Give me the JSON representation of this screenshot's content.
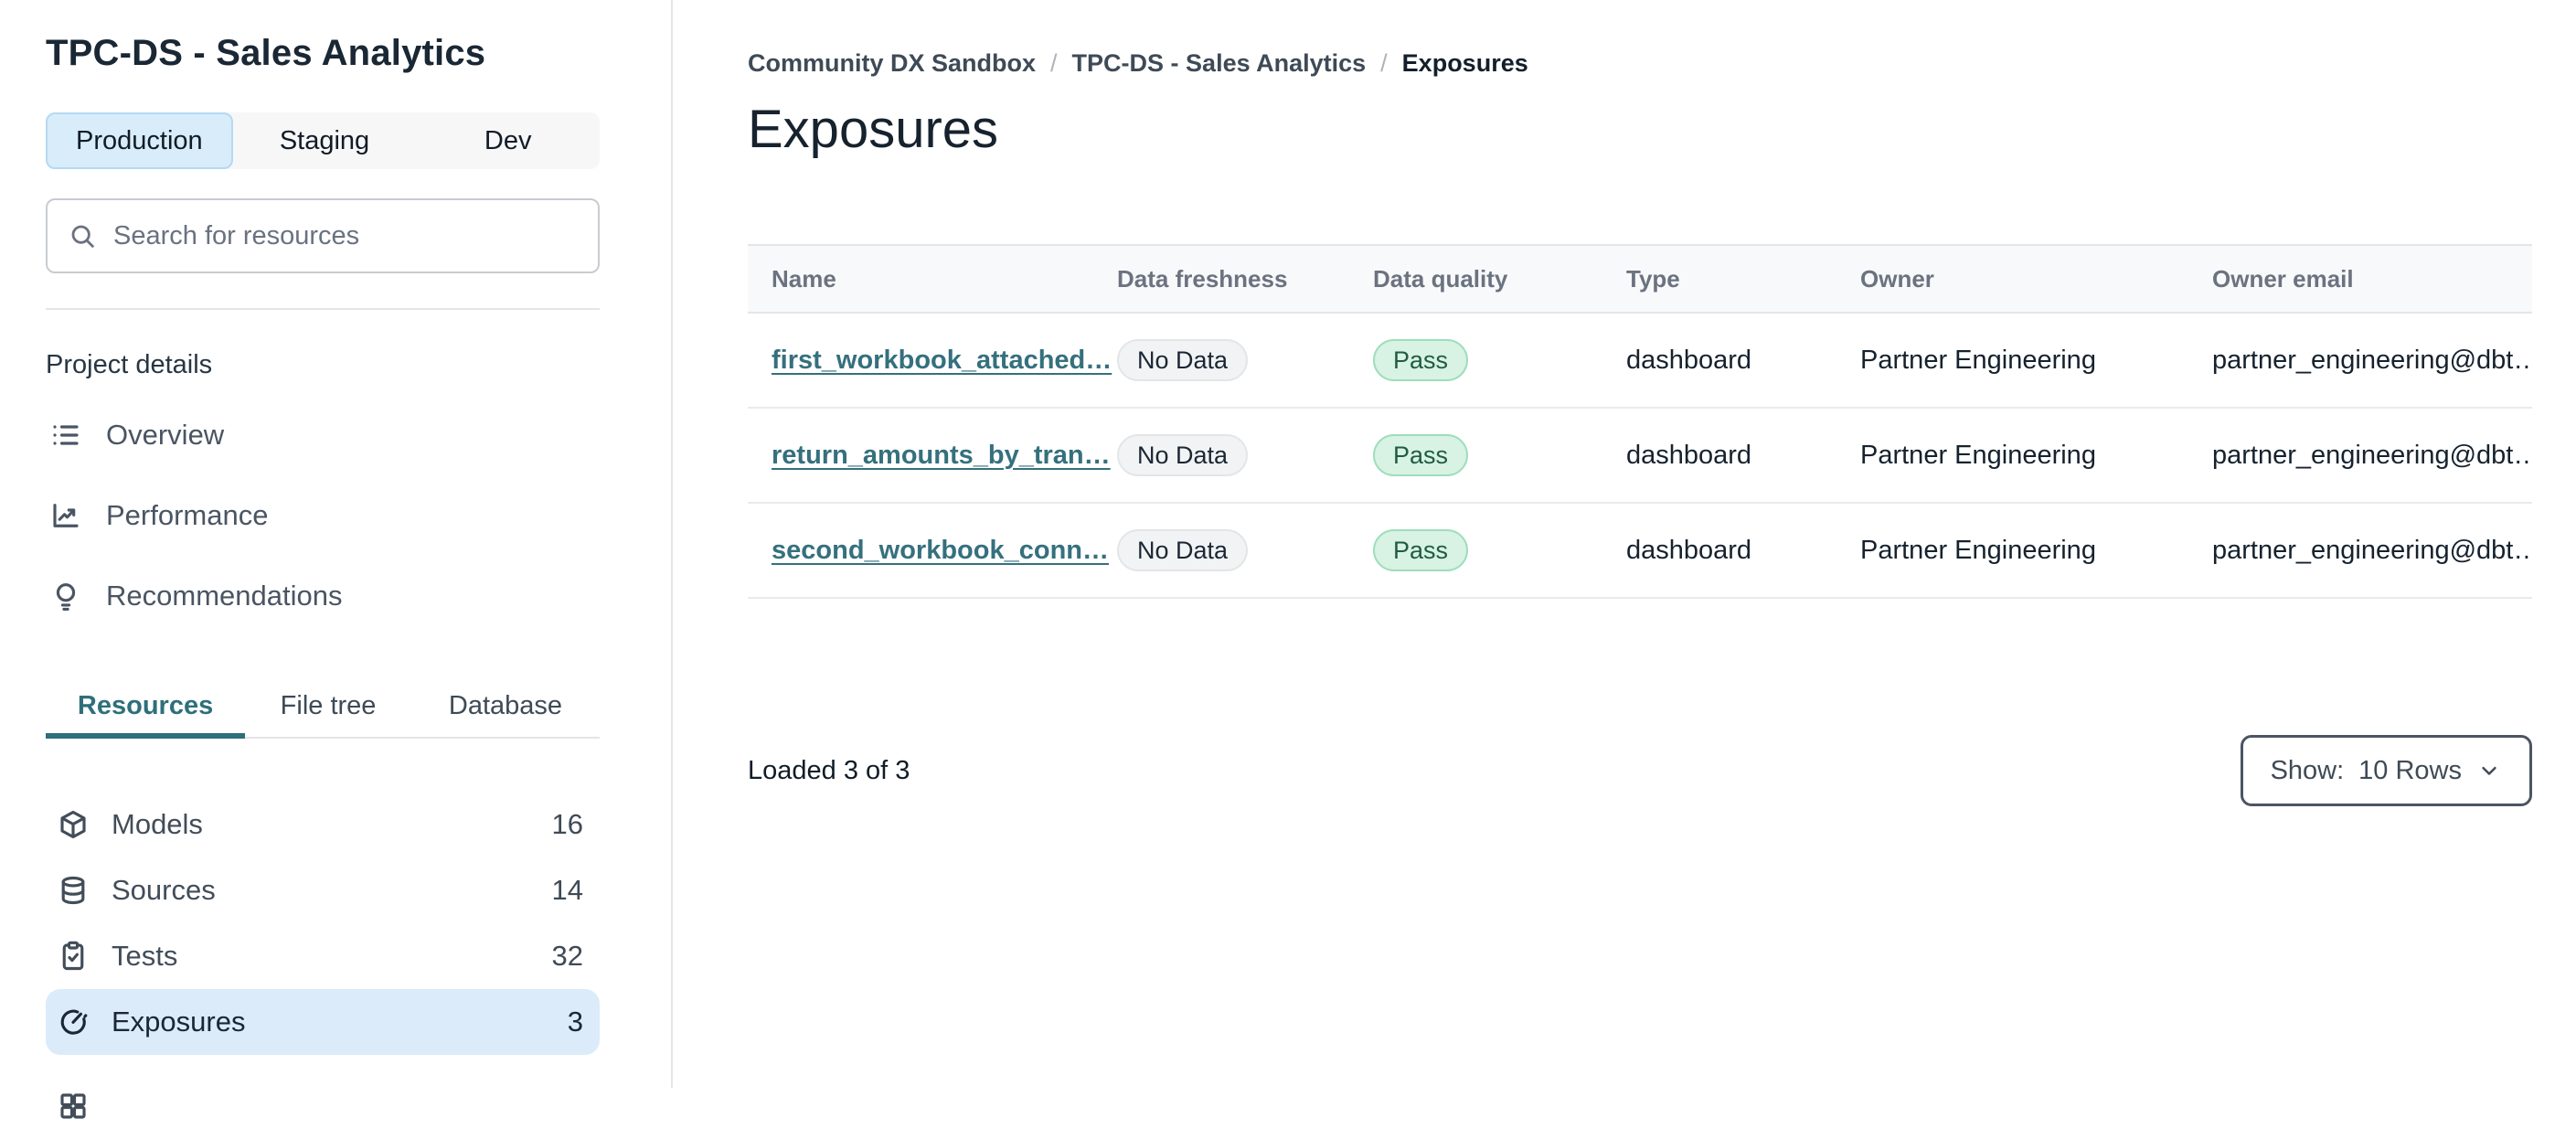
{
  "sidebar": {
    "title": "TPC-DS - Sales Analytics",
    "env_tabs": [
      {
        "label": "Production",
        "active": true
      },
      {
        "label": "Staging",
        "active": false
      },
      {
        "label": "Dev",
        "active": false
      }
    ],
    "search": {
      "placeholder": "Search for resources",
      "icon": "search-icon"
    },
    "section_label": "Project details",
    "nav": [
      {
        "label": "Overview",
        "icon": "list-icon"
      },
      {
        "label": "Performance",
        "icon": "chart-line-icon"
      },
      {
        "label": "Recommendations",
        "icon": "lightbulb-icon"
      }
    ],
    "view_tabs": [
      {
        "label": "Resources",
        "active": true
      },
      {
        "label": "File tree",
        "active": false
      },
      {
        "label": "Database",
        "active": false
      }
    ],
    "resources": [
      {
        "label": "Models",
        "count": "16",
        "icon": "cube-icon",
        "active": false
      },
      {
        "label": "Sources",
        "count": "14",
        "icon": "database-icon",
        "active": false
      },
      {
        "label": "Tests",
        "count": "32",
        "icon": "clipboard-check-icon",
        "active": false
      },
      {
        "label": "Exposures",
        "count": "3",
        "icon": "gauge-icon",
        "active": true
      }
    ],
    "partial_item_icon": "grid-icon"
  },
  "main": {
    "breadcrumb": [
      {
        "label": "Community DX Sandbox"
      },
      {
        "label": "TPC-DS - Sales Analytics"
      },
      {
        "label": "Exposures"
      }
    ],
    "title": "Exposures",
    "table": {
      "columns": [
        "Name",
        "Data freshness",
        "Data quality",
        "Type",
        "Owner",
        "Owner email"
      ],
      "rows": [
        {
          "name": "first_workbook_attached…",
          "freshness": "No Data",
          "quality": "Pass",
          "type": "dashboard",
          "owner": "Partner Engineering",
          "owner_email": "partner_engineering@dbt…"
        },
        {
          "name": "return_amounts_by_tran…",
          "freshness": "No Data",
          "quality": "Pass",
          "type": "dashboard",
          "owner": "Partner Engineering",
          "owner_email": "partner_engineering@dbt…"
        },
        {
          "name": "second_workbook_conn…",
          "freshness": "No Data",
          "quality": "Pass",
          "type": "dashboard",
          "owner": "Partner Engineering",
          "owner_email": "partner_engineering@dbt…"
        }
      ]
    },
    "footer": {
      "loaded_text": "Loaded 3 of 3",
      "show_label": "Show:",
      "show_value": "10 Rows"
    }
  },
  "colors": {
    "accent_teal": "#2e6f7a",
    "link_teal": "#35707d",
    "selected_tab_bg": "#d9ecfa",
    "selected_tab_border": "#b5d9f3",
    "sidebar_selected_bg": "#dcebf9",
    "badge_neutral_bg": "#f2f3f4",
    "badge_pass_bg": "#d8f2e3",
    "badge_pass_text": "#205c41",
    "text_dark": "#16222e",
    "text_slate": "#4a5563",
    "header_text_gray": "#6b7280",
    "border_gray": "#e4e6e8"
  }
}
